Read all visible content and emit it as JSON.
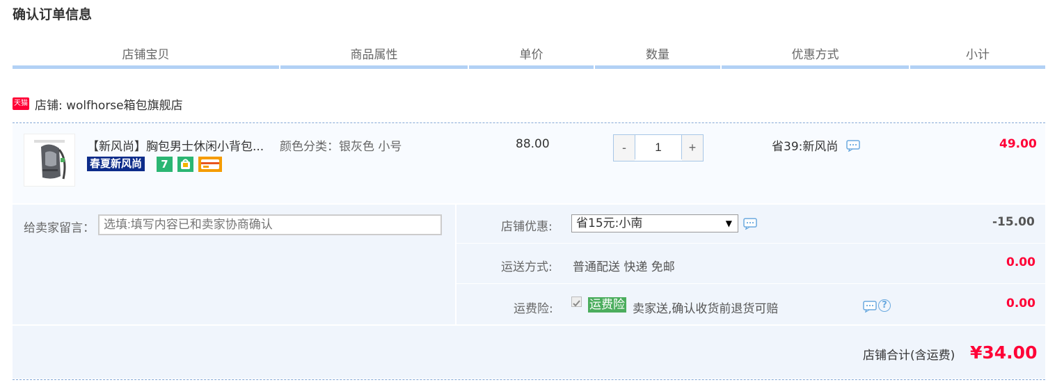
{
  "page_title": "确认订单信息",
  "columns": [
    "店铺宝贝",
    "商品属性",
    "单价",
    "数量",
    "优惠方式",
    "小计"
  ],
  "shop": {
    "badge": "天猫",
    "label": "店铺: wolfhorse箱包旗舰店"
  },
  "item": {
    "name": "【新风尚】胸包男士休闲小背包...",
    "attributes": "颜色分类：银灰色 小号",
    "badge_main": "春夏新风尚",
    "badge_seven": "7",
    "price": "88.00",
    "quantity": "1",
    "qty_minus": "-",
    "qty_plus": "+",
    "discount": "省39:新风尚",
    "subtotal": "49.00"
  },
  "message": {
    "label": "给卖家留言：",
    "placeholder": "选填:填写内容已和卖家协商确认"
  },
  "shop_discount": {
    "label": "店铺优惠:",
    "selected": "省15元:小南",
    "arrow": "▼",
    "value": "-15.00"
  },
  "shipping": {
    "label": "运送方式:",
    "text": "普通配送 快递 免邮",
    "value": "0.00"
  },
  "insurance": {
    "label": "运费险:",
    "tag": "运费险",
    "text": "卖家送,确认收货前退货可赔",
    "help": "?",
    "value": "0.00",
    "checked": true
  },
  "total": {
    "label": "店铺合计(含运费)",
    "value": "¥34.00"
  },
  "colors": {
    "accent_red": "#ff0036",
    "header_line": "#b2d1f5",
    "panel_bg": "#f0f5fc",
    "tag_green": "#4bad5d"
  }
}
